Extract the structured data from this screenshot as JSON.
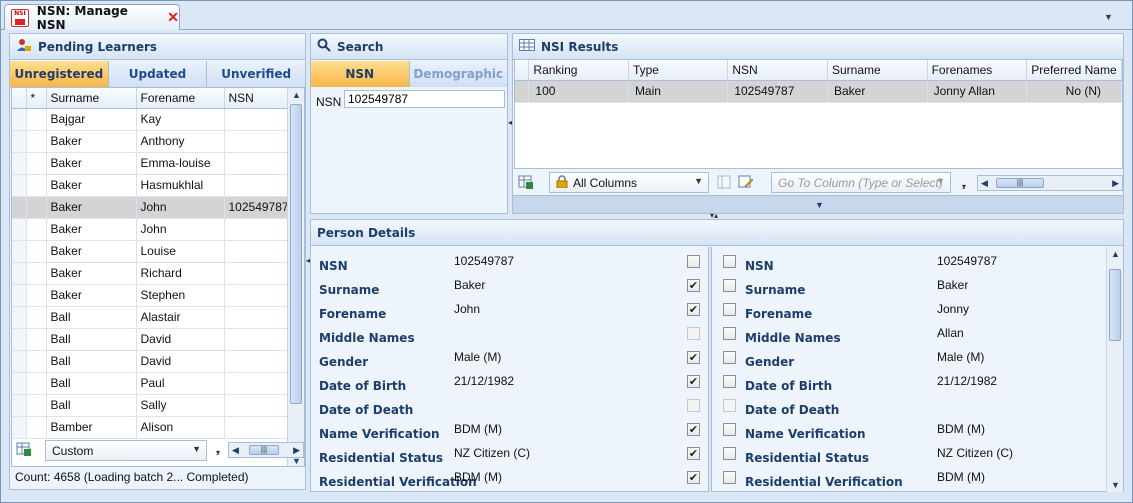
{
  "tab": {
    "logo_text": "NSI",
    "title": "NSN: Manage NSN",
    "close_glyph": "✕"
  },
  "pending": {
    "title": "Pending Learners",
    "tabs": [
      "Unregistered",
      "Updated",
      "Unverified"
    ],
    "columns": [
      "*",
      "Surname",
      "Forename",
      "NSN"
    ],
    "rows": [
      [
        "Bajgar",
        "Kay",
        ""
      ],
      [
        "Baker",
        "Anthony",
        ""
      ],
      [
        "Baker",
        "Emma-louise",
        ""
      ],
      [
        "Baker",
        "Hasmukhlal",
        ""
      ],
      [
        "Baker",
        "John",
        "102549787"
      ],
      [
        "Baker",
        "John",
        ""
      ],
      [
        "Baker",
        "Louise",
        ""
      ],
      [
        "Baker",
        "Richard",
        ""
      ],
      [
        "Baker",
        "Stephen",
        ""
      ],
      [
        "Ball",
        "Alastair",
        ""
      ],
      [
        "Ball",
        "David",
        ""
      ],
      [
        "Ball",
        "David",
        ""
      ],
      [
        "Ball",
        "Paul",
        ""
      ],
      [
        "Ball",
        "Sally",
        ""
      ],
      [
        "Bamber",
        "Alison",
        ""
      ]
    ],
    "selected_row": 4,
    "filter_value": "Custom",
    "status": "Count: 4658 (Loading batch 2... Completed)"
  },
  "search": {
    "title": "Search",
    "tabs": [
      "NSN",
      "Demographic"
    ],
    "field_label": "NSN",
    "field_value": "102549787"
  },
  "results": {
    "title": "NSI Results",
    "columns": [
      "Ranking",
      "Type",
      "NSN",
      "Surname",
      "Forenames",
      "Preferred Name"
    ],
    "rows": [
      [
        "100",
        "Main",
        "102549787",
        "Baker",
        "Jonny Allan",
        "No (N)"
      ]
    ],
    "columns_filter": "All Columns",
    "goto_placeholder": "Go To Column (Type or Select)"
  },
  "person_details": {
    "title": "Person Details",
    "fields": [
      {
        "label": "NSN",
        "left": "102549787",
        "right": "102549787",
        "left_checked": false,
        "left_disabled": false,
        "right_checked": false,
        "right_disabled": false
      },
      {
        "label": "Surname",
        "left": "Baker",
        "right": "Baker",
        "left_checked": true,
        "left_disabled": false,
        "right_checked": false,
        "right_disabled": false
      },
      {
        "label": "Forename",
        "left": "John",
        "right": "Jonny",
        "left_checked": true,
        "left_disabled": false,
        "right_checked": false,
        "right_disabled": false
      },
      {
        "label": "Middle Names",
        "left": "",
        "right": "Allan",
        "left_checked": false,
        "left_disabled": true,
        "right_checked": false,
        "right_disabled": false
      },
      {
        "label": "Gender",
        "left": "Male (M)",
        "right": "Male (M)",
        "left_checked": true,
        "left_disabled": false,
        "right_checked": false,
        "right_disabled": false
      },
      {
        "label": "Date of Birth",
        "left": "21/12/1982",
        "right": "21/12/1982",
        "left_checked": true,
        "left_disabled": false,
        "right_checked": false,
        "right_disabled": false
      },
      {
        "label": "Date of Death",
        "left": "",
        "right": "",
        "left_checked": false,
        "left_disabled": true,
        "right_checked": false,
        "right_disabled": true
      },
      {
        "label": "Name Verification",
        "left": "BDM (M)",
        "right": "BDM (M)",
        "left_checked": true,
        "left_disabled": false,
        "right_checked": false,
        "right_disabled": false
      },
      {
        "label": "Residential Status",
        "left": "NZ Citizen (C)",
        "right": "NZ Citizen (C)",
        "left_checked": true,
        "left_disabled": false,
        "right_checked": false,
        "right_disabled": false
      },
      {
        "label": "Residential Verification",
        "left": "BDM (M)",
        "right": "BDM (M)",
        "left_checked": true,
        "left_disabled": false,
        "right_checked": false,
        "right_disabled": false
      }
    ]
  },
  "colors": {
    "accent_tab": "#f7b549",
    "header_text": "#1d3d6b",
    "selection": "#d4d4d4",
    "close": "#d42020"
  }
}
